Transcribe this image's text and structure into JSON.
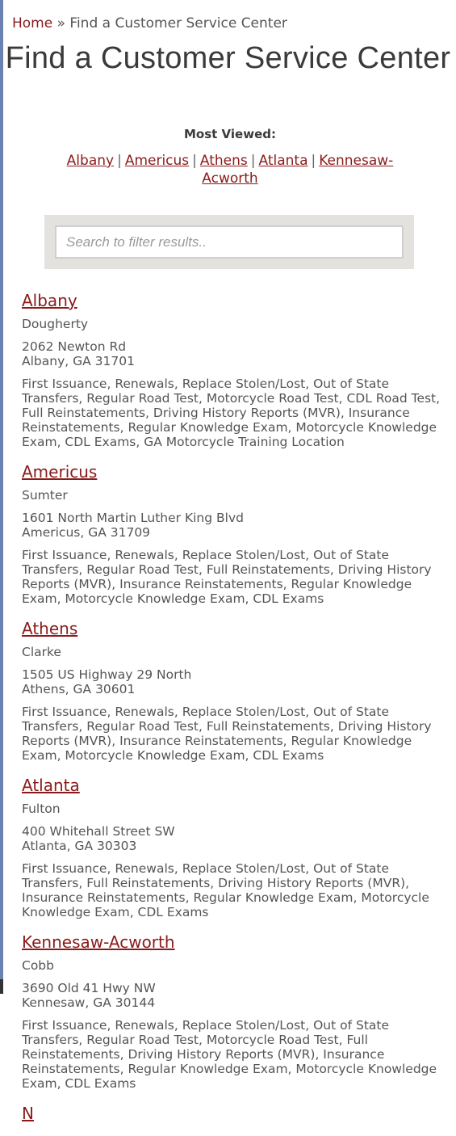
{
  "breadcrumb": {
    "home": "Home",
    "separator": "»",
    "current": "Find a Customer Service Center"
  },
  "page_title": "Find a Customer Service Center",
  "most_viewed": {
    "label": "Most Viewed:",
    "separator": "|",
    "links": [
      "Albany",
      "Americus",
      "Athens",
      "Atlanta",
      "Kennesaw-Acworth"
    ]
  },
  "search": {
    "placeholder": "Search to filter results..",
    "value": ""
  },
  "colors": {
    "link": "#8b1a1a",
    "text": "#555555",
    "search_panel": "#e3e2df",
    "left_strip": "#6b82b0"
  },
  "locations": [
    {
      "name": "Albany",
      "county": "Dougherty",
      "address_line1": "2062 Newton Rd",
      "address_line2": "Albany, GA 31701",
      "services": "First Issuance, Renewals, Replace Stolen/Lost, Out of State Transfers, Regular Road Test, Motorcycle Road Test, CDL Road Test, Full Reinstatements, Driving History Reports (MVR), Insurance Reinstatements, Regular Knowledge Exam, Motorcycle Knowledge Exam, CDL Exams, GA Motorcycle Training Location"
    },
    {
      "name": "Americus",
      "county": "Sumter",
      "address_line1": "1601 North Martin Luther King Blvd",
      "address_line2": "Americus, GA 31709",
      "services": "First Issuance, Renewals, Replace Stolen/Lost, Out of State Transfers, Regular Road Test, Full Reinstatements, Driving History Reports (MVR), Insurance Reinstatements, Regular Knowledge Exam, Motorcycle Knowledge Exam, CDL Exams"
    },
    {
      "name": "Athens",
      "county": "Clarke",
      "address_line1": "1505 US Highway 29 North",
      "address_line2": "Athens, GA 30601",
      "services": "First Issuance, Renewals, Replace Stolen/Lost, Out of State Transfers, Regular Road Test, Full Reinstatements, Driving History Reports (MVR), Insurance Reinstatements, Regular Knowledge Exam, Motorcycle Knowledge Exam, CDL Exams"
    },
    {
      "name": "Atlanta",
      "county": "Fulton",
      "address_line1": "400 Whitehall Street SW",
      "address_line2": "Atlanta, GA 30303",
      "services": "First Issuance, Renewals, Replace Stolen/Lost, Out of State Transfers, Full Reinstatements, Driving History Reports (MVR), Insurance Reinstatements, Regular Knowledge Exam, Motorcycle Knowledge Exam, CDL Exams"
    },
    {
      "name": "Kennesaw-Acworth",
      "county": "Cobb",
      "address_line1": "3690 Old 41 Hwy NW",
      "address_line2": "Kennesaw, GA 30144",
      "services": "First Issuance, Renewals, Replace Stolen/Lost, Out of State Transfers, Regular Road Test, Motorcycle Road Test, Full Reinstatements, Driving History Reports (MVR), Insurance Reinstatements, Regular Knowledge Exam, Motorcycle Knowledge Exam, CDL Exams"
    },
    {
      "name": "N",
      "county": "",
      "address_line1": "",
      "address_line2": "",
      "services": ""
    }
  ]
}
